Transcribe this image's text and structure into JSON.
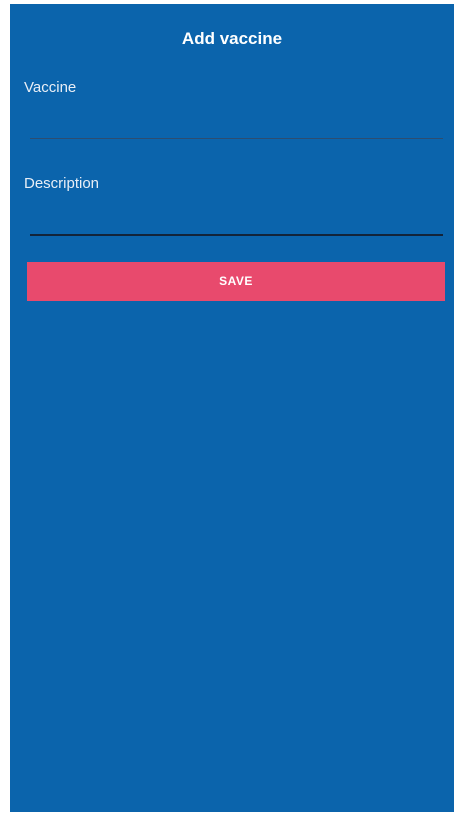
{
  "header": {
    "title": "Add vaccine"
  },
  "form": {
    "vaccine": {
      "label": "Vaccine",
      "value": ""
    },
    "description": {
      "label": "Description",
      "value": ""
    },
    "save_label": "SAVE"
  },
  "colors": {
    "background": "#0b64ac",
    "button": "#e84a6d",
    "text": "#ffffff"
  }
}
